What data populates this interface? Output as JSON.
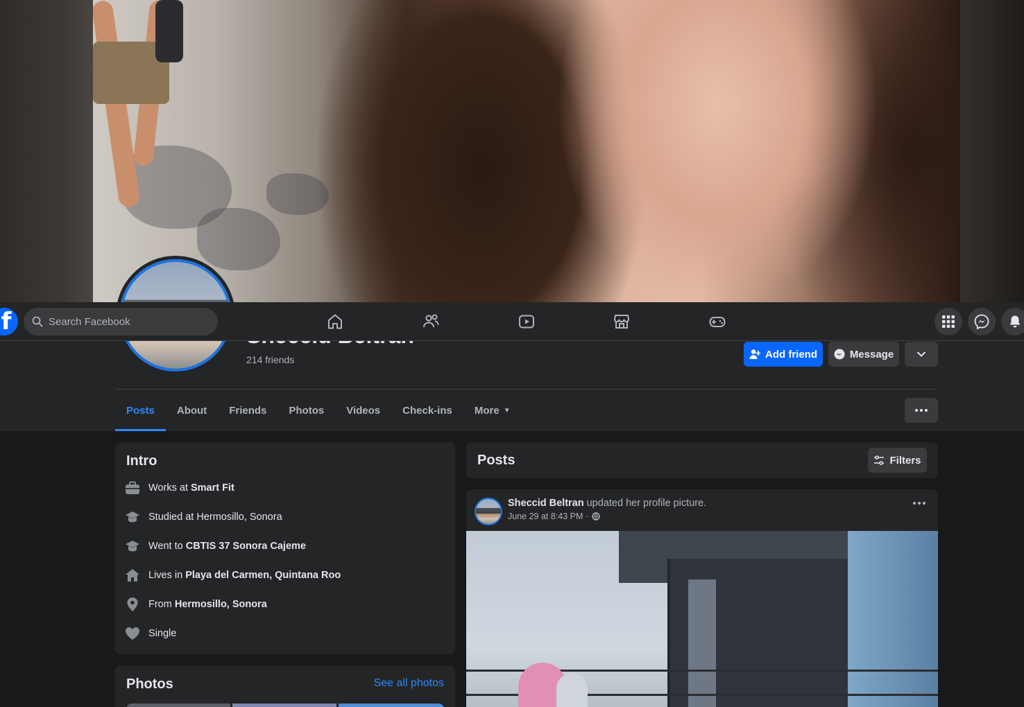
{
  "nav": {
    "search_placeholder": "Search Facebook",
    "tabs": [
      "home-icon",
      "friends-icon",
      "watch-icon",
      "marketplace-icon",
      "gaming-icon"
    ],
    "right_icons": [
      "menu-grid-icon",
      "messenger-icon",
      "bell-icon"
    ]
  },
  "profile": {
    "name": "Sheccid Beltran",
    "friends": "214 friends",
    "add_friend_label": "Add friend",
    "message_label": "Message"
  },
  "tabs": [
    "Posts",
    "About",
    "Friends",
    "Photos",
    "Videos",
    "Check-ins",
    "More"
  ],
  "intro": {
    "title": "Intro",
    "items": [
      {
        "icon": "briefcase-icon",
        "prefix": "Works at ",
        "bold": "Smart Fit"
      },
      {
        "icon": "graduation-cap-icon",
        "prefix": "Studied at Hermosillo, Sonora",
        "bold": ""
      },
      {
        "icon": "graduation-cap-icon",
        "prefix": "Went to ",
        "bold": "CBTIS 37 Sonora Cajeme"
      },
      {
        "icon": "home-location-icon",
        "prefix": "Lives in ",
        "bold": "Playa del Carmen, Quintana Roo"
      },
      {
        "icon": "location-pin-icon",
        "prefix": "From ",
        "bold": "Hermosillo, Sonora"
      },
      {
        "icon": "heart-icon",
        "prefix": "Single",
        "bold": ""
      }
    ]
  },
  "photos": {
    "title": "Photos",
    "see_all": "See all photos"
  },
  "posts": {
    "title": "Posts",
    "filters_label": "Filters"
  },
  "post": {
    "author": "Sheccid Beltran",
    "action": " updated her profile picture.",
    "time": "June 29 at 8:43 PM",
    "separator": "·",
    "privacy_icon": "globe-icon"
  },
  "colors": {
    "accent": "#2d88ff",
    "primary_button": "#0866ff",
    "surface": "#242526",
    "background": "#18191a"
  }
}
